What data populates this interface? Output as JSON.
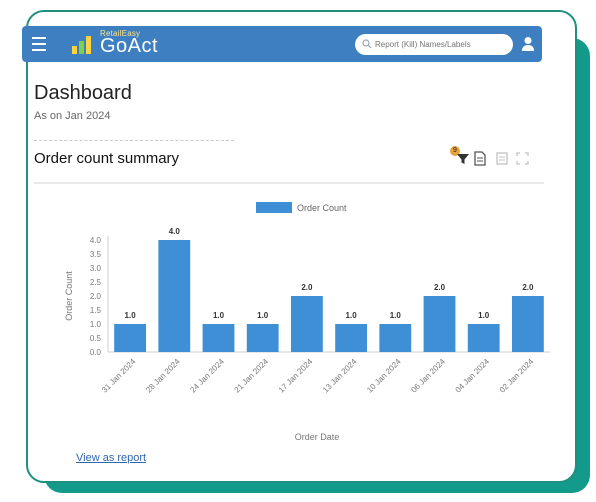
{
  "header": {
    "brand_small": "RetailEasy",
    "brand_main": "GoAct",
    "search_placeholder": "Report (Kill) Names/Labels"
  },
  "page": {
    "title": "Dashboard",
    "subtitle": "As on Jan 2024"
  },
  "section": {
    "title": "Order count summary",
    "filter_badge": "9"
  },
  "chart_data": {
    "type": "bar",
    "legend": "Order Count",
    "xlabel": "Order Date",
    "ylabel": "Order Count",
    "ylim": [
      0,
      4.0
    ],
    "yticks": [
      "0.0",
      "0.5",
      "1.0",
      "1.5",
      "2.0",
      "2.5",
      "3.0",
      "3.5",
      "4.0"
    ],
    "categories": [
      "31 Jan 2024",
      "28 Jan 2024",
      "24 Jan 2024",
      "21 Jan 2024",
      "17 Jan 2024",
      "13 Jan 2024",
      "10 Jan 2024",
      "06 Jan 2024",
      "04 Jan 2024",
      "02 Jan 2024"
    ],
    "values": [
      1.0,
      4.0,
      1.0,
      1.0,
      2.0,
      1.0,
      1.0,
      2.0,
      1.0,
      2.0
    ],
    "labels": [
      "1.0",
      "4.0",
      "1.0",
      "1.0",
      "2.0",
      "1.0",
      "1.0",
      "2.0",
      "1.0",
      "2.0"
    ],
    "color": "#3f8fd6"
  },
  "footer": {
    "link": "View as report"
  },
  "colors": {
    "topbar": "#3d7fc1",
    "accent_card": "#139a8a"
  }
}
